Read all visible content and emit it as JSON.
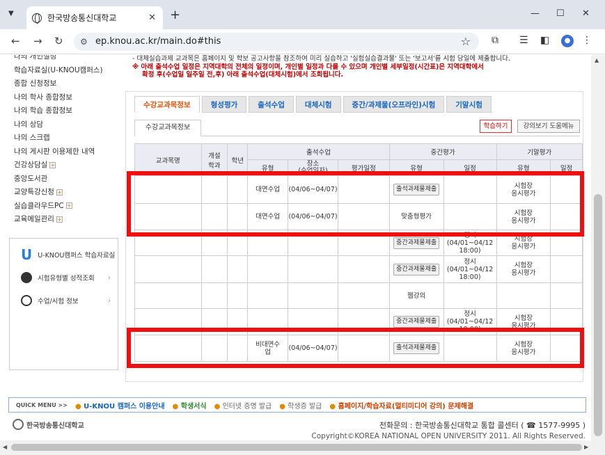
{
  "browser": {
    "tab_title": "한국방송통신대학교",
    "url": "ep.knou.ac.kr/main.do#this",
    "new_tab": "+",
    "close": "✕",
    "min": "—",
    "max": "☐"
  },
  "sidebar": {
    "items": [
      {
        "label": "나의 개인설정",
        "plus": false
      },
      {
        "label": "학습자료실(U-KNOU캠퍼스)",
        "plus": false
      },
      {
        "label": "종합 신청정보",
        "plus": false
      },
      {
        "label": "나의 학사 종합정보",
        "plus": false
      },
      {
        "label": "나의 학습 종합정보",
        "plus": false
      },
      {
        "label": "나의 상담",
        "plus": false
      },
      {
        "label": "나의 스크랩",
        "plus": false
      },
      {
        "label": "나의 게시판 이용제한 내역",
        "plus": false
      },
      {
        "label": "건강상담실",
        "plus": true
      },
      {
        "label": "중앙도서관",
        "plus": false
      },
      {
        "label": "교양특강신청",
        "plus": true
      },
      {
        "label": "실습클라우드PC",
        "plus": true
      },
      {
        "label": "교육메일관리",
        "plus": true
      }
    ],
    "box": {
      "ucampus": "U-KNOU캠퍼스 학습자료실",
      "exam": "시험유형별 성적조회",
      "class": "수업/시험 정보"
    }
  },
  "notice": {
    "line1": "- 대체실습과제 교과목은 홈페이지 및 학보 공고사항을 참조하여 미리 실습하고 '실험실습결과물' 또는 '보고서'를 시험 당일에 제출합니다.",
    "line2": "※ 아래 출석수업 일정은 지역대학의 전체의 일정이며, 개인별 일정과 다를 수 있으며 개인별 세부일정(시간표)은 지역대학에서",
    "line3": "확정 후(수업일 일주일 전,후) 아래 출석수업(대체시험)에서 조회됩니다."
  },
  "tabs": [
    "수강교과목정보",
    "형성평가",
    "출석수업",
    "대체시험",
    "중간/과제물(오프라인)시험",
    "기말시험"
  ],
  "subtab": "수강교과목정보",
  "buttons": {
    "study": "학습하기",
    "help": "강의보기 도움메뉴"
  },
  "table": {
    "headers": {
      "subject": "교과목명",
      "open_a": "개설",
      "open_b": "학과",
      "grade": "학년",
      "attend": "출석수업",
      "mid": "중간평가",
      "final": "기말평가",
      "type": "유형",
      "place": "장소",
      "place_sub": "(수업일자)",
      "eval": "평가일정",
      "mtype": "유형",
      "msched": "일정",
      "ftype": "유형",
      "fsched": "일정"
    },
    "rows": [
      {
        "a_type": "대면수업",
        "a_place": "(04/06~04/07)",
        "m_type": "출석과제물제출",
        "m_btn": true,
        "m_sched": "",
        "f_type": "시험장\n응시평가"
      },
      {
        "a_type": "대면수업",
        "a_place": "(04/06~04/07)",
        "m_type": "맞춤형평가",
        "m_btn": false,
        "m_sched": "",
        "f_type": "시험장\n응시평가"
      },
      {
        "a_type": "",
        "a_place": "",
        "m_type": "중간과제물제출",
        "m_btn": true,
        "m_sched": "정시\n(04/01~04/12\n18:00)",
        "f_type": "시험장\n응시평가"
      },
      {
        "a_type": "",
        "a_place": "",
        "m_type": "중간과제물제출",
        "m_btn": true,
        "m_sched": "정시\n(04/01~04/12\n18:00)",
        "f_type": "시험장\n응시평가"
      },
      {
        "a_type": "",
        "a_place": "",
        "m_type": "웹강의",
        "m_btn": false,
        "m_sched": "",
        "f_type": ""
      },
      {
        "a_type": "",
        "a_place": "",
        "m_type": "중간과제물제출",
        "m_btn": true,
        "m_sched": "정시\n(04/01~04/12\n18:00)",
        "f_type": "시험장\n응시평가"
      },
      {
        "a_type": "비대면수\n업",
        "a_place": "(04/06~04/07)",
        "m_type": "출석과제물제출",
        "m_btn": true,
        "m_sched": "",
        "f_type": "시험장\n응시평가"
      }
    ]
  },
  "footer": {
    "quick": "QUICK MENU  >>",
    "links": [
      "U-KNOU 캠퍼스 이용안내",
      "학생서식",
      "인터넷 증명 발급",
      "학생증 발급",
      "홈페이지/학습자료(멀티미디어 강의) 문제해결"
    ],
    "logo": "한국방송통신대학교",
    "contact": "전화문의 : 한국방송통신대학교 통합 콜센터 ( ☎ 1577-9995 )",
    "copyright": "Copyright©KOREA NATIONAL OPEN UNIVERSITY 2011. All Rights Reserved."
  }
}
